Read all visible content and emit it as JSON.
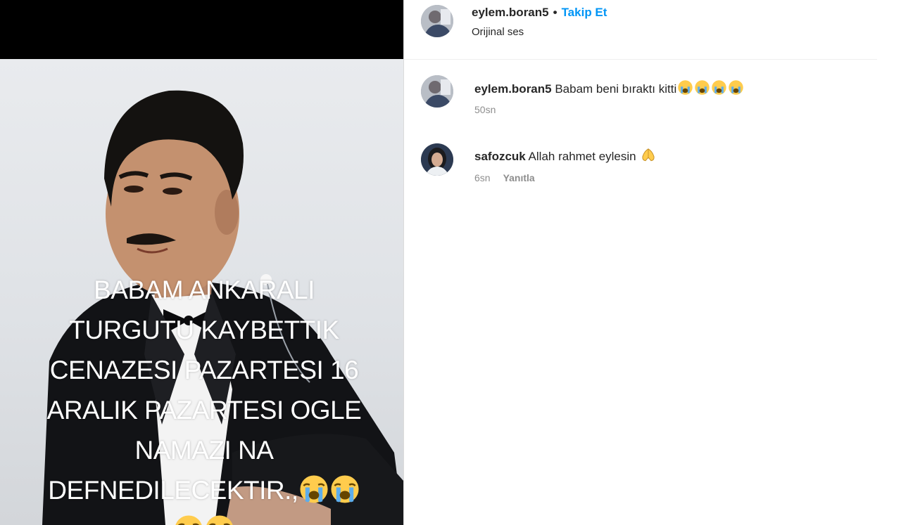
{
  "post": {
    "overlay_text": "BABAM ANKARALI\nTURGUTU KAYBETTIK\nCENAZESI PAZARTESI 16\nARALIK PAZARTESI OGLE\nNAMAZI NA\nDEFNEDILECEKTIR.,",
    "overlay_emoji": "loudly-crying-face"
  },
  "header": {
    "username": "eylem.boran5",
    "separator": "•",
    "follow_label": "Takip Et",
    "audio_label": "Orijinal ses"
  },
  "comments": [
    {
      "username": "eylem.boran5",
      "text": "Babam beni bıraktı kitti",
      "emoji": "loudly-crying-face",
      "emoji_count": 4,
      "time": "50sn",
      "reply_label": ""
    },
    {
      "username": "safozcuk",
      "text": "Allah rahmet eylesin",
      "emoji": "folded-hands",
      "emoji_count": 1,
      "time": "6sn",
      "reply_label": "Yanıtla"
    }
  ],
  "colors": {
    "follow": "#0095f6",
    "meta": "#8e8e8e",
    "text": "#262626"
  }
}
